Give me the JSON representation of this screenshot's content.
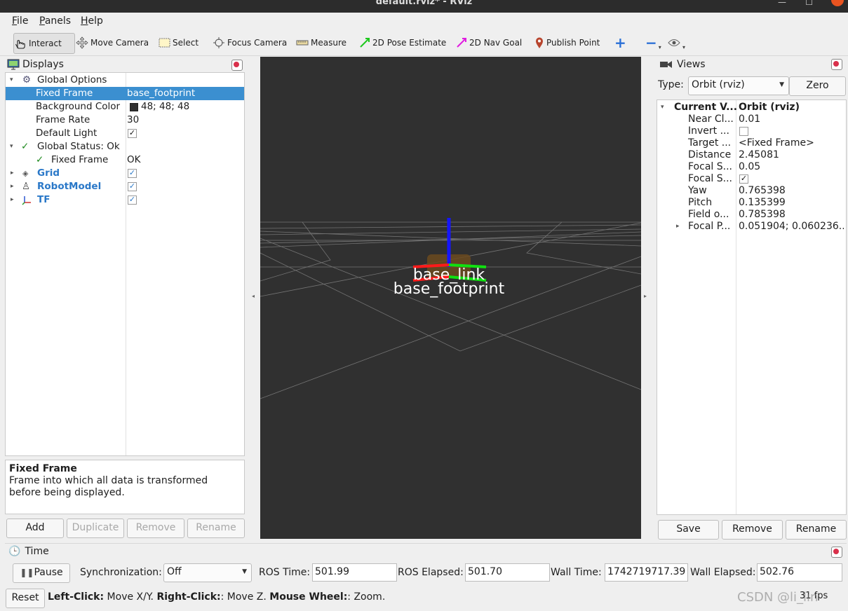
{
  "window": {
    "title": "default.rviz* - RViz"
  },
  "menu": [
    "File",
    "Panels",
    "Help"
  ],
  "toolbar": {
    "interact": "Interact",
    "move_camera": "Move Camera",
    "select": "Select",
    "focus_camera": "Focus Camera",
    "measure": "Measure",
    "pose_estimate": "2D Pose Estimate",
    "nav_goal": "2D Nav Goal",
    "publish_point": "Publish Point"
  },
  "displays": {
    "title": "Displays",
    "rows": {
      "global_options": "Global Options",
      "fixed_frame": {
        "label": "Fixed Frame",
        "value": "base_footprint"
      },
      "background_color": {
        "label": "Background Color",
        "value": "48; 48; 48",
        "color": "#303030"
      },
      "frame_rate": {
        "label": "Frame Rate",
        "value": "30"
      },
      "default_light": {
        "label": "Default Light",
        "checked": true
      },
      "global_status": "Global Status: Ok",
      "status_fixed_frame": {
        "label": "Fixed Frame",
        "value": "OK"
      },
      "grid": "Grid",
      "robot_model": "RobotModel",
      "tf": "TF"
    },
    "description": {
      "title": "Fixed Frame",
      "text": "Frame into which all data is transformed before being displayed."
    },
    "buttons": {
      "add": "Add",
      "duplicate": "Duplicate",
      "remove": "Remove",
      "rename": "Rename"
    }
  },
  "viewport": {
    "background": "#303030",
    "labels": {
      "link": "base_link",
      "footprint": "base_footprint"
    }
  },
  "views": {
    "title": "Views",
    "type_label": "Type:",
    "type_value": "Orbit (rviz)",
    "zero": "Zero",
    "rows": [
      {
        "label": "Current V...",
        "value": "Orbit (rviz)"
      },
      {
        "label": "Near Cl...",
        "value": "0.01"
      },
      {
        "label": "Invert ...",
        "value": ""
      },
      {
        "label": "Target ...",
        "value": "<Fixed Frame>"
      },
      {
        "label": "Distance",
        "value": "2.45081"
      },
      {
        "label": "Focal S...",
        "value": "0.05"
      },
      {
        "label": "Focal S...",
        "value": ""
      },
      {
        "label": "Yaw",
        "value": "0.765398"
      },
      {
        "label": "Pitch",
        "value": "0.135399"
      },
      {
        "label": "Field o...",
        "value": "0.785398"
      },
      {
        "label": "Focal P...",
        "value": "0.051904; 0.060236..."
      }
    ],
    "buttons": {
      "save": "Save",
      "remove": "Remove",
      "rename": "Rename"
    }
  },
  "time": {
    "title": "Time",
    "pause": "Pause",
    "sync_label": "Synchronization:",
    "sync_value": "Off",
    "ros_time_label": "ROS Time:",
    "ros_time": "501.99",
    "ros_elapsed_label": "ROS Elapsed:",
    "ros_elapsed": "501.70",
    "wall_time_label": "Wall Time:",
    "wall_time": "1742719717.39",
    "wall_elapsed_label": "Wall Elapsed:",
    "wall_elapsed": "502.76"
  },
  "statusbar": {
    "reset": "Reset",
    "hint_left_bold": "Left-Click:",
    "hint_left": " Move X/Y. ",
    "hint_right_bold": "Right-Click:",
    "hint_right": ": Move Z. ",
    "hint_wheel_bold": "Mouse Wheel:",
    "hint_wheel": ": Zoom.",
    "fps": "31 fps",
    "watermark": "CSDN @li_lin"
  }
}
